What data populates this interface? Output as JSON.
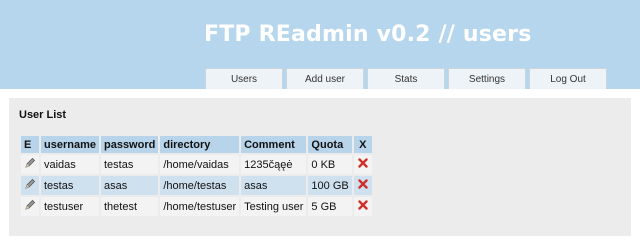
{
  "app": {
    "title": "FTP REadmin v0.2 // users"
  },
  "tabs": [
    {
      "label": "Users"
    },
    {
      "label": "Add user"
    },
    {
      "label": "Stats"
    },
    {
      "label": "Settings"
    },
    {
      "label": "Log Out"
    }
  ],
  "user_list": {
    "title": "User List",
    "columns": [
      "E",
      "username",
      "password",
      "directory",
      "Comment",
      "Quota",
      "X"
    ],
    "rows": [
      {
        "username": "vaidas",
        "password": "testas",
        "directory": "/home/vaidas",
        "comment": "1235čąęė",
        "quota": "0 KB"
      },
      {
        "username": "testas",
        "password": "asas",
        "directory": "/home/testas",
        "comment": "asas",
        "quota": "100 GB"
      },
      {
        "username": "testuser",
        "password": "thetest",
        "directory": "/home/testuser",
        "comment": "Testing user",
        "quota": "5 GB"
      }
    ]
  },
  "icons": {
    "edit": "pencil-icon",
    "delete": "red-x-icon"
  },
  "colors": {
    "header_bg": "#b5d6ec",
    "table_header_bg": "#b7d4ea",
    "row_alt_bg": "#cfe1ef",
    "delete_red": "#d0302a"
  }
}
